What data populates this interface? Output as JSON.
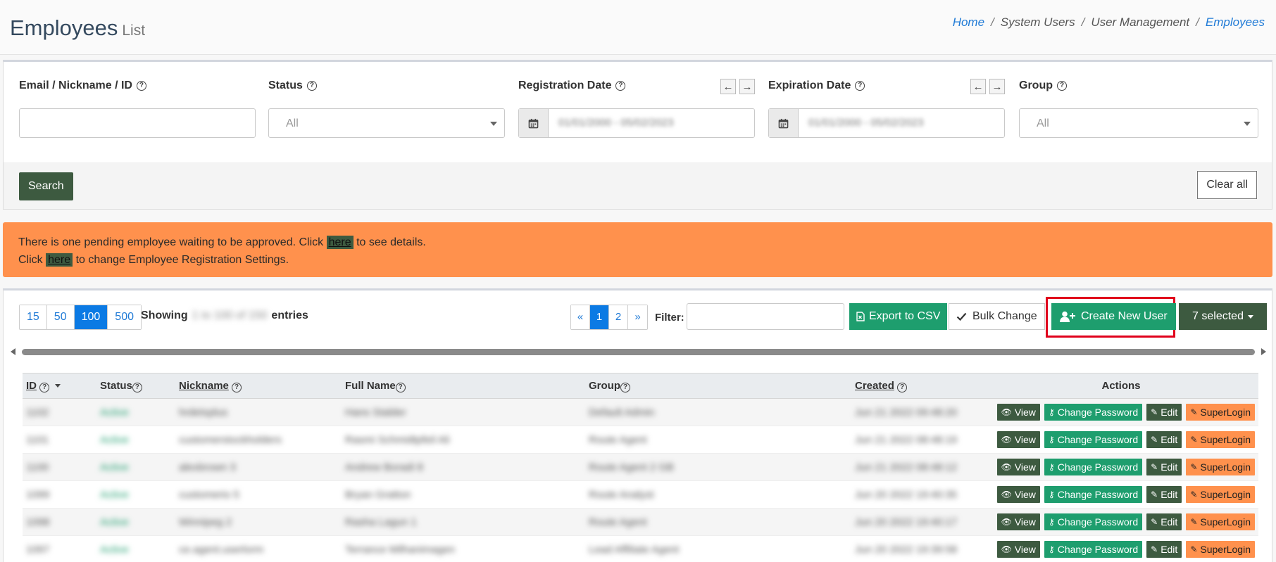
{
  "header": {
    "title": "Employees",
    "subtitle": "List",
    "breadcrumb": [
      "Home",
      "System Users",
      "User Management",
      "Employees"
    ]
  },
  "filters": {
    "email_label": "Email / Nickname / ID",
    "status_label": "Status",
    "status_value": "All",
    "registration_label": "Registration Date",
    "registration_value": "01/01/2000 - 05/02/2023",
    "expiration_label": "Expiration Date",
    "expiration_value": "01/01/2000 - 05/02/2023",
    "group_label": "Group",
    "group_value": "All",
    "search_label": "Search",
    "clear_label": "Clear all"
  },
  "alert": {
    "line1_pre": "There is one pending employee waiting to be approved. Click",
    "line1_link": "here",
    "line1_post": "to see details.",
    "line2_pre": "Click",
    "line2_link": "here",
    "line2_post": "to change Employee Registration Settings."
  },
  "toolbar": {
    "page_sizes": [
      "15",
      "50",
      "100",
      "500"
    ],
    "active_page_size": "100",
    "showing_label": "Showing",
    "showing_value": "1 to 100 of 150",
    "entries_label": "entries",
    "pages": [
      "«",
      "1",
      "2",
      "»"
    ],
    "filter_label": "Filter:",
    "export_label": "Export to CSV",
    "bulk_label": "Bulk Change",
    "create_label": "Create New User",
    "selected_label": "7 selected"
  },
  "table": {
    "columns": [
      "ID",
      "Status",
      "Nickname",
      "Full Name",
      "Group",
      "Created",
      "Actions"
    ],
    "rows": [
      {
        "id": "1102",
        "status": "Active",
        "nickname": "hrdetsplus",
        "full_name": "Hans Stalder",
        "group": "Default Admin",
        "created": "Jun 21 2022 09:48:20"
      },
      {
        "id": "1101",
        "status": "Active",
        "nickname": "customerstockholders",
        "full_name": "Rasmi Schmidtpfeil Ali",
        "group": "Route Agent",
        "created": "Jun 21 2022 08:48:19"
      },
      {
        "id": "1100",
        "status": "Active",
        "nickname": "alexbrown 3",
        "full_name": "Andrew Boradi 8",
        "group": "Route Agent 2 GB",
        "created": "Jun 21 2022 08:48:12"
      },
      {
        "id": "1099",
        "status": "Active",
        "nickname": "customerio 5",
        "full_name": "Bryan Gratton",
        "group": "Route Analyst",
        "created": "Jun 20 2022 19:40:35"
      },
      {
        "id": "1098",
        "status": "Active",
        "nickname": "Winnipeg 2",
        "full_name": "Rasha Lagun 1",
        "group": "Route Agent",
        "created": "Jun 20 2022 19:40:17"
      },
      {
        "id": "1097",
        "status": "Active",
        "nickname": "ce.agent.userlorm",
        "full_name": "Terrance Milhanimagen",
        "group": "Lead Affiliate Agent",
        "created": "Jun 20 2022 19:39:58"
      }
    ],
    "actions": {
      "view": "View",
      "password": "Change Password",
      "edit": "Edit",
      "super": "SuperLogin"
    }
  },
  "colors": {
    "accent_dark_green": "#3d5a40",
    "accent_green": "#1e9e6e",
    "alert_orange": "#ff914d",
    "link_blue": "#1f7ad6",
    "highlight_red": "#e0001b"
  }
}
